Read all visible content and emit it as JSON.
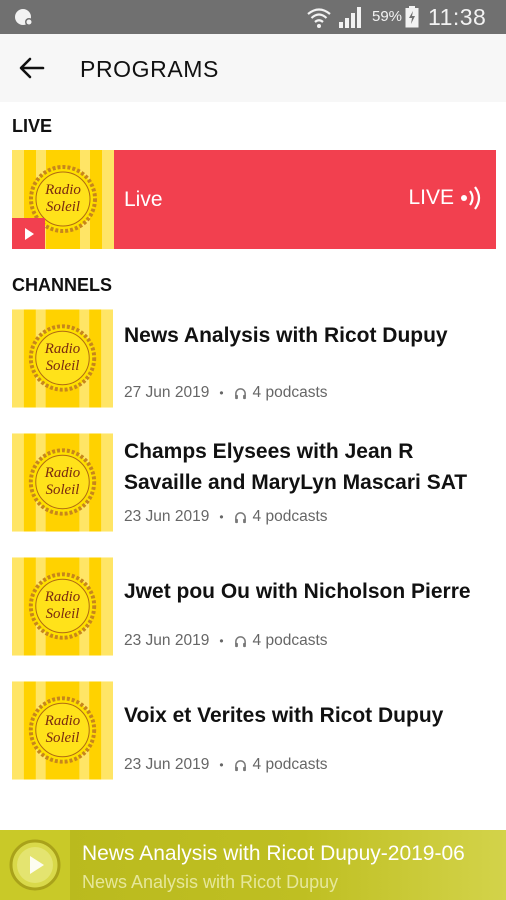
{
  "status_bar": {
    "battery_percent": "59%",
    "time": "11:38"
  },
  "app_bar": {
    "title": "PROGRAMS"
  },
  "live_section": {
    "heading": "LIVE",
    "item_label": "Live",
    "badge_label": "LIVE",
    "logo_text": [
      "Radio",
      "Soleil"
    ]
  },
  "channels_section": {
    "heading": "CHANNELS",
    "items": [
      {
        "title": "News Analysis with Ricot Dupuy",
        "date": "27 Jun 2019",
        "podcasts": "4 podcasts"
      },
      {
        "title": "Champs Elysees with Jean R Savaille and MaryLyn Mascari SAT",
        "date": "23 Jun 2019",
        "podcasts": "4 podcasts"
      },
      {
        "title": "Jwet pou Ou with Nicholson Pierre",
        "date": "23 Jun 2019",
        "podcasts": "4 podcasts"
      },
      {
        "title": "Voix et Verites with Ricot Dupuy",
        "date": "23 Jun 2019",
        "podcasts": "4 podcasts"
      }
    ]
  },
  "mini_player": {
    "title": "News Analysis with Ricot Dupuy-2019-06",
    "subtitle": "News Analysis with Ricot Dupuy"
  },
  "colors": {
    "live_red": "#f2404f",
    "logo_yellow": "#ffd200",
    "player_olive": "#bfbf22"
  }
}
